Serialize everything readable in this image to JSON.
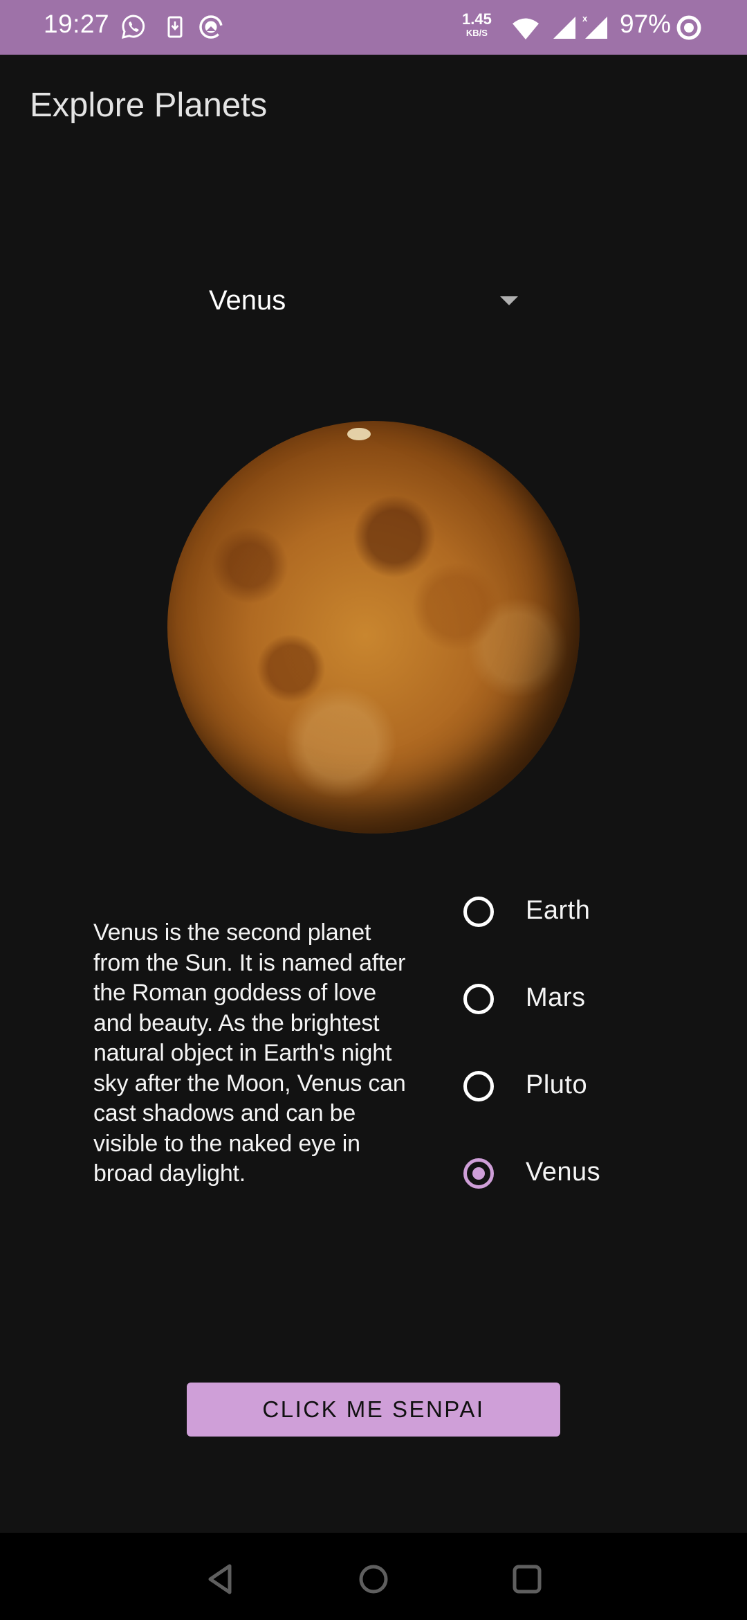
{
  "status_bar": {
    "time": "19:27",
    "notification_icons": [
      "whatsapp-icon",
      "download-to-phone-icon",
      "data-saver-icon"
    ],
    "net_speed_value": "1.45",
    "net_speed_unit": "KB/S",
    "system_icons": [
      "wifi-icon",
      "signal-icon",
      "signal-no-data-icon"
    ],
    "battery_percent": "97%",
    "battery_icon": "battery-ring-icon",
    "background_color": "#9e72a8"
  },
  "app": {
    "title": "Explore Planets"
  },
  "planet_selector": {
    "selected": "Venus",
    "icon": "dropdown-arrow-icon"
  },
  "planet_image": {
    "subject": "Venus"
  },
  "description": "Venus is the second planet from the Sun. It is named after the Roman goddess of love and beauty. As the brightest natural object in Earth's night sky after the Moon, Venus can cast shadows and can be visible to the naked eye in broad daylight.",
  "radio_options": [
    {
      "label": "Earth",
      "checked": false
    },
    {
      "label": "Mars",
      "checked": false
    },
    {
      "label": "Pluto",
      "checked": false
    },
    {
      "label": "Venus",
      "checked": true
    }
  ],
  "button": {
    "label": "CLICK ME SENPAI",
    "color": "#cf9fd8"
  },
  "nav_bar": {
    "buttons": [
      "back-icon",
      "home-icon",
      "recents-icon"
    ]
  },
  "colors": {
    "accent": "#cf9fd8",
    "background": "#121212"
  }
}
